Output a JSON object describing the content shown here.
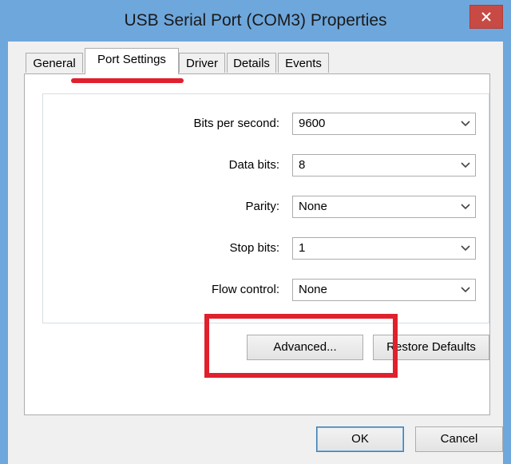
{
  "window": {
    "title": "USB Serial Port (COM3) Properties"
  },
  "tabs": [
    {
      "label": "General"
    },
    {
      "label": "Port Settings"
    },
    {
      "label": "Driver"
    },
    {
      "label": "Details"
    },
    {
      "label": "Events"
    }
  ],
  "active_tab": "Port Settings",
  "settings": {
    "bits_per_second": {
      "label": "Bits per second:",
      "value": "9600"
    },
    "data_bits": {
      "label": "Data bits:",
      "value": "8"
    },
    "parity": {
      "label": "Parity:",
      "value": "None"
    },
    "stop_bits": {
      "label": "Stop bits:",
      "value": "1"
    },
    "flow_control": {
      "label": "Flow control:",
      "value": "None"
    }
  },
  "buttons": {
    "advanced": "Advanced...",
    "restore_defaults": "Restore Defaults",
    "ok": "OK",
    "cancel": "Cancel"
  },
  "colors": {
    "title_bar": "#6ea7dc",
    "close_button": "#c74a44",
    "annotation_red": "#e0202c"
  },
  "icons": [
    "close-icon",
    "chevron-down-icon"
  ]
}
